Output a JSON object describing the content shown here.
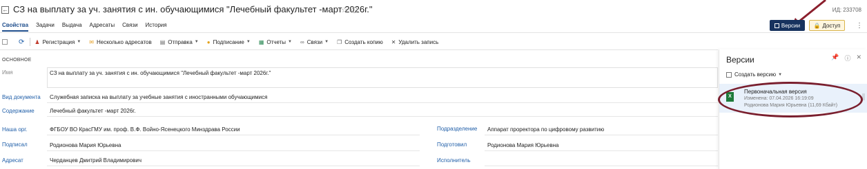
{
  "header": {
    "title": "СЗ на выплату за уч. занятия с ин. обучающимися \"Лечебный факультет -март 2026г.\"",
    "id_label": "ИД: 233708",
    "versions_button": "Версии",
    "access_button": "Доступ"
  },
  "tabs": [
    "Свойства",
    "Задачи",
    "Выдача",
    "Адресаты",
    "Связи",
    "История"
  ],
  "toolbar": {
    "registration": "Регистрация",
    "multiple_addressees": "Несколько адресатов",
    "send": "Отправка",
    "signing": "Подписание",
    "reports": "Отчеты",
    "links": "Связи",
    "create_copy": "Создать копию",
    "delete_record": "Удалить запись"
  },
  "form": {
    "section": "ОСНОВНОЕ",
    "name_label": "Имя",
    "name_value": "СЗ на выплату за уч. занятия с ин. обучающимися \"Лечебный факультет -март 2026г.\"",
    "doc_type_label": "Вид документа",
    "doc_type_value": "Служебная записка на выплату за учебные занятия с иностранными обучающимися",
    "content_label": "Содержание",
    "content_value": "Лечебный факультет -март 2026г.",
    "org_label": "Наша орг.",
    "org_value": "ФГБОУ ВО КрасГМУ им. проф. В.Ф. Войно-Ясенецкого Минздрава России",
    "dept_label": "Подразделение",
    "dept_value": "Аппарат проректора по цифровому развитию",
    "signed_label": "Подписал",
    "signed_value": "Родионова Мария Юрьевна",
    "prepared_label": "Подготовил",
    "prepared_value": "Родионова Мария Юрьевна",
    "addressee_label": "Адресат",
    "addressee_value": "Черданцев Дмитрий Владимирович",
    "executor_label": "Исполнитель"
  },
  "versions_panel": {
    "title": "Версии",
    "create_version": "Создать версию",
    "items": [
      {
        "name": "Первоначальная версия",
        "changed": "Изменена: 07.04.2026 16:19:09",
        "author": "Родионова Мария Юрьевна (11,69 Кбайт)",
        "icon": "excel-file-icon"
      }
    ]
  },
  "colors": {
    "accent": "#17325e",
    "link": "#1f5ea8",
    "access_bg": "#fff6df",
    "highlight_oval": "#7a1f2e",
    "selected_row": "#e9f1fb"
  }
}
